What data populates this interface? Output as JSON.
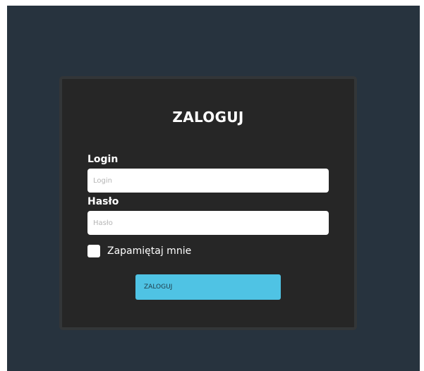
{
  "login_form": {
    "title": "ZALOGUJ",
    "login_label": "Login",
    "login_placeholder": "Login",
    "password_label": "Hasło",
    "password_placeholder": "Hasło",
    "remember_label": "Zapamiętaj mnie",
    "remember_checked": false,
    "submit_label": "ZALOGUJ"
  },
  "colors": {
    "page_background": "#27333e",
    "card_background": "#262626",
    "accent": "#4fc3e4"
  }
}
